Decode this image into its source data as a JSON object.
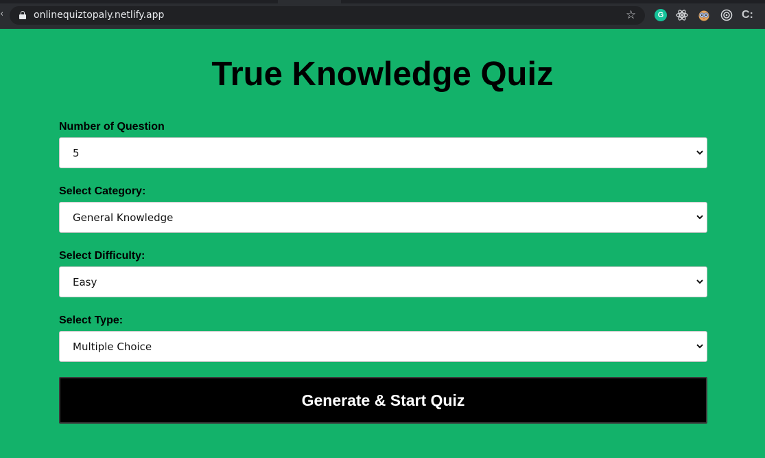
{
  "browser": {
    "url": "onlinequiztopaly.netlify.app",
    "icons": [
      "back-icon",
      "lock-icon",
      "star-icon",
      "grammarly-icon",
      "react-devtools-icon",
      "owl-extension-icon",
      "target-extension-icon",
      "c-extension-icon"
    ],
    "grammarly_letter": "G",
    "c_letter": "C:"
  },
  "page": {
    "title": "True Knowledge Quiz",
    "background_color": "#13b26a"
  },
  "form": {
    "fields": [
      {
        "label": "Number of Question",
        "value": "5"
      },
      {
        "label": "Select Category:",
        "value": "General Knowledge"
      },
      {
        "label": "Select Difficulty:",
        "value": "Easy"
      },
      {
        "label": "Select Type:",
        "value": "Multiple Choice"
      }
    ],
    "submit_label": "Generate & Start Quiz"
  }
}
